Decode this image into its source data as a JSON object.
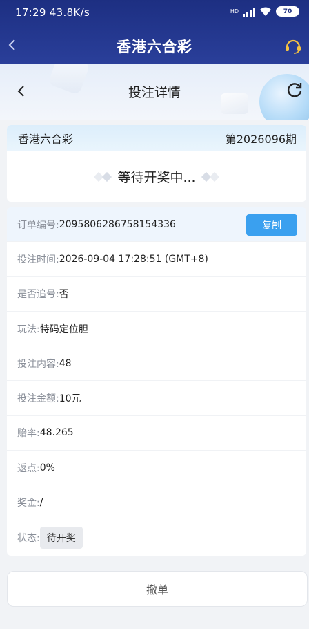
{
  "status_bar": {
    "time": "17:29",
    "speed": "43.8K/s",
    "network": "HD",
    "battery": "70"
  },
  "header": {
    "title": "香港六合彩"
  },
  "sub_header": {
    "title": "投注详情"
  },
  "lottery": {
    "name": "香港六合彩",
    "period": "第2026096期",
    "status_text": "等待开奖中..."
  },
  "details": {
    "order_no_label": "订单编号:",
    "order_no": "2095806286758154336",
    "copy_label": "复制",
    "bet_time_label": "投注时间:",
    "bet_time": "2026-09-04 17:28:51 (GMT+8)",
    "chase_label": "是否追号:",
    "chase": "否",
    "play_label": "玩法:",
    "play": "特码定位胆",
    "content_label": "投注内容:",
    "content": "48",
    "amount_label": "投注金额:",
    "amount": "10元",
    "odds_label": "赔率:",
    "odds": "48.265",
    "rebate_label": "返点:",
    "rebate": "0%",
    "prize_label": "奖金:",
    "prize": "/",
    "state_label": "状态:",
    "state": "待开奖"
  },
  "actions": {
    "cancel_label": "撤单"
  },
  "colors": {
    "header_bg": "#1d2f82",
    "accent_button": "#3aa0ef",
    "page_bg": "#f1f3f6"
  },
  "icons": {
    "back": "chevron-left-icon",
    "service": "headset-icon",
    "refresh": "refresh-icon"
  }
}
